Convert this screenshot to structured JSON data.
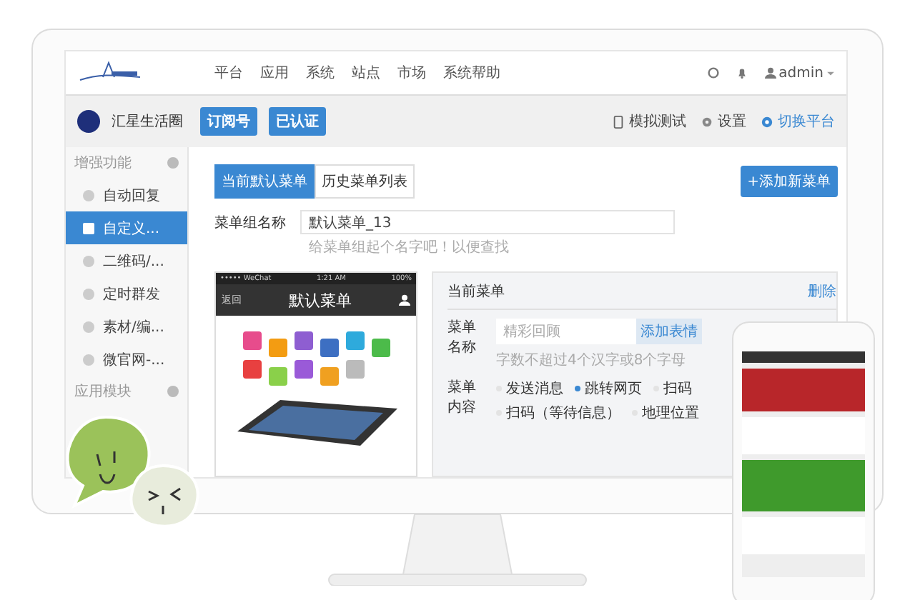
{
  "nav": {
    "menu": [
      "平台",
      "应用",
      "系统",
      "站点",
      "市场",
      "系统帮助"
    ],
    "user": "admin"
  },
  "account": {
    "name": "汇星生活圈",
    "badges": [
      "订阅号",
      "已认证"
    ],
    "actions": [
      {
        "kind": "phone",
        "label": "模拟测试"
      },
      {
        "kind": "gear",
        "label": "设置"
      },
      {
        "kind": "dot",
        "label": "切换平台"
      }
    ]
  },
  "sidebar": {
    "sections": [
      {
        "title": "增强功能",
        "items": [
          {
            "label": "自动回复",
            "selected": false
          },
          {
            "label": "自定义...",
            "selected": true
          },
          {
            "label": "二维码/...",
            "selected": false
          },
          {
            "label": "定时群发",
            "selected": false
          },
          {
            "label": "素材/编...",
            "selected": false
          },
          {
            "label": "微官网-...",
            "selected": false
          }
        ]
      },
      {
        "title": "应用模块"
      }
    ]
  },
  "tabs": [
    {
      "label": "当前默认菜单",
      "selected": true
    },
    {
      "label": "历史菜单列表",
      "selected": false
    }
  ],
  "add_button": "+添加新菜单",
  "group_name": {
    "label": "菜单组名称",
    "value": "默认菜单_13",
    "hint": "给菜单组起个名字吧！以便查找"
  },
  "preview": {
    "carrier": "••••• WeChat",
    "time": "1:21 AM",
    "battery": "100%",
    "back": "返回",
    "title": "默认菜单"
  },
  "editor": {
    "title": "当前菜单",
    "delete": "删除",
    "name_label": "菜单名称",
    "name_placeholder": "精彩回顾",
    "emoji_button": "添加表情",
    "name_hint": "字数不超过4个汉字或8个字母",
    "content_label": "菜单内容",
    "options": [
      {
        "label": "发送消息",
        "selected": false
      },
      {
        "label": "跳转网页",
        "selected": true
      },
      {
        "label": "扫码",
        "selected": false
      },
      {
        "label": "扫码（等待信息）",
        "selected": false
      },
      {
        "label": "地理位置",
        "selected": false
      }
    ]
  }
}
